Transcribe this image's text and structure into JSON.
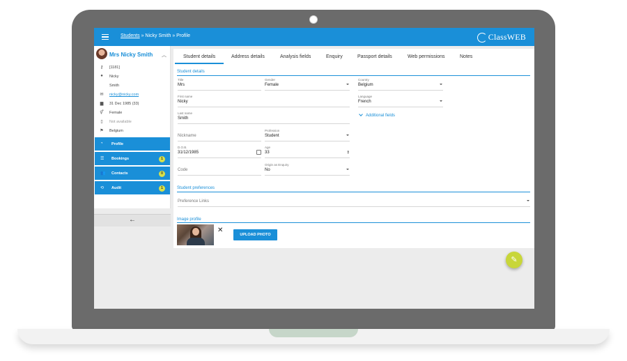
{
  "topbar": {
    "breadcrumb_link": "Students",
    "breadcrumb_rest": " » Nicky Smith » Profile",
    "logo_text": "ClassWEB"
  },
  "user": {
    "name": "Mrs Nicky Smith",
    "info": {
      "id": "[1181]",
      "first_name": "Nicky",
      "last_name": "Smith",
      "email": "nicky@nicky.com",
      "dob": "31 Dec 1985 (33)",
      "gender": "Female",
      "phone": "Not available",
      "country": "Belgium"
    }
  },
  "nav": {
    "profile": "Profile",
    "bookings": "Bookings",
    "bookings_count": "1",
    "contacts": "Contacts",
    "contacts_count": "0",
    "audit": "Audit",
    "audit_count": "1"
  },
  "tabs": {
    "student_details": "Student details",
    "address_details": "Address details",
    "analysis_fields": "Analysis fields",
    "enquiry": "Enquiry",
    "passport_details": "Passport details",
    "web_permissions": "Web permissions",
    "notes": "Notes"
  },
  "sections": {
    "student_details": "Student details",
    "student_preferences": "Student preferences",
    "image_profile": "Image profile"
  },
  "form": {
    "title": {
      "label": "Title",
      "value": "Mrs"
    },
    "gender": {
      "label": "Gender",
      "value": "Female"
    },
    "country": {
      "label": "Country",
      "value": "Belgium"
    },
    "first_name": {
      "label": "First name",
      "value": "Nicky"
    },
    "language": {
      "label": "Language",
      "value": "French"
    },
    "last_name": {
      "label": "Last name",
      "value": "Smith"
    },
    "nickname": {
      "placeholder": "Nickname"
    },
    "profession": {
      "label": "Profession",
      "value": "Student"
    },
    "dob": {
      "label": "D.O.B.",
      "value": "31/12/1985"
    },
    "age": {
      "label": "Age",
      "value": "33"
    },
    "code": {
      "placeholder": "Code"
    },
    "origin": {
      "label": "Origin as Enquiry",
      "value": "No"
    },
    "additional_fields": "Additional fields",
    "preference_links": {
      "placeholder": "Preference Links"
    }
  },
  "image": {
    "remove_glyph": "✕",
    "upload_label": "UPLOAD PHOTO"
  },
  "icons": {
    "brand_color": "#1a8fd8",
    "fab_color": "#c8d63a"
  }
}
